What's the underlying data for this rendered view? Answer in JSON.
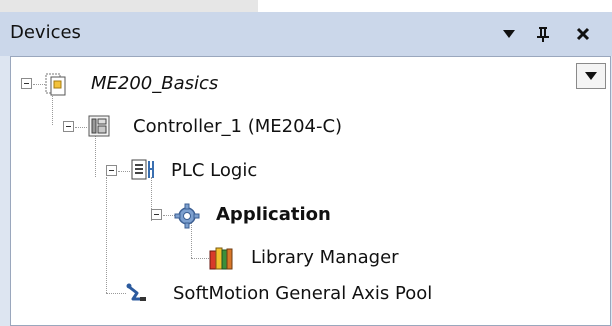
{
  "panel": {
    "title": "Devices"
  },
  "titlebar_buttons": [
    {
      "name": "dropdown-menu-button",
      "icon": "triangle-down-icon"
    },
    {
      "name": "pin-button",
      "icon": "pin-icon"
    },
    {
      "name": "close-button",
      "icon": "close-icon"
    }
  ],
  "tree": {
    "dropdown_icon": "triangle-down-icon",
    "nodes": [
      {
        "label": "ME200_Basics",
        "icon": "project-icon",
        "style": "italic"
      },
      {
        "label": "Controller_1 (ME204-C)",
        "icon": "controller-icon",
        "style": "normal"
      },
      {
        "label": "PLC Logic",
        "icon": "plc-logic-icon",
        "style": "normal"
      },
      {
        "label": "Application",
        "icon": "gear-icon",
        "style": "bold"
      },
      {
        "label": "Library Manager",
        "icon": "library-books-icon",
        "style": "normal"
      },
      {
        "label": "SoftMotion General Axis Pool",
        "icon": "axis-pool-icon",
        "style": "normal"
      }
    ]
  }
}
